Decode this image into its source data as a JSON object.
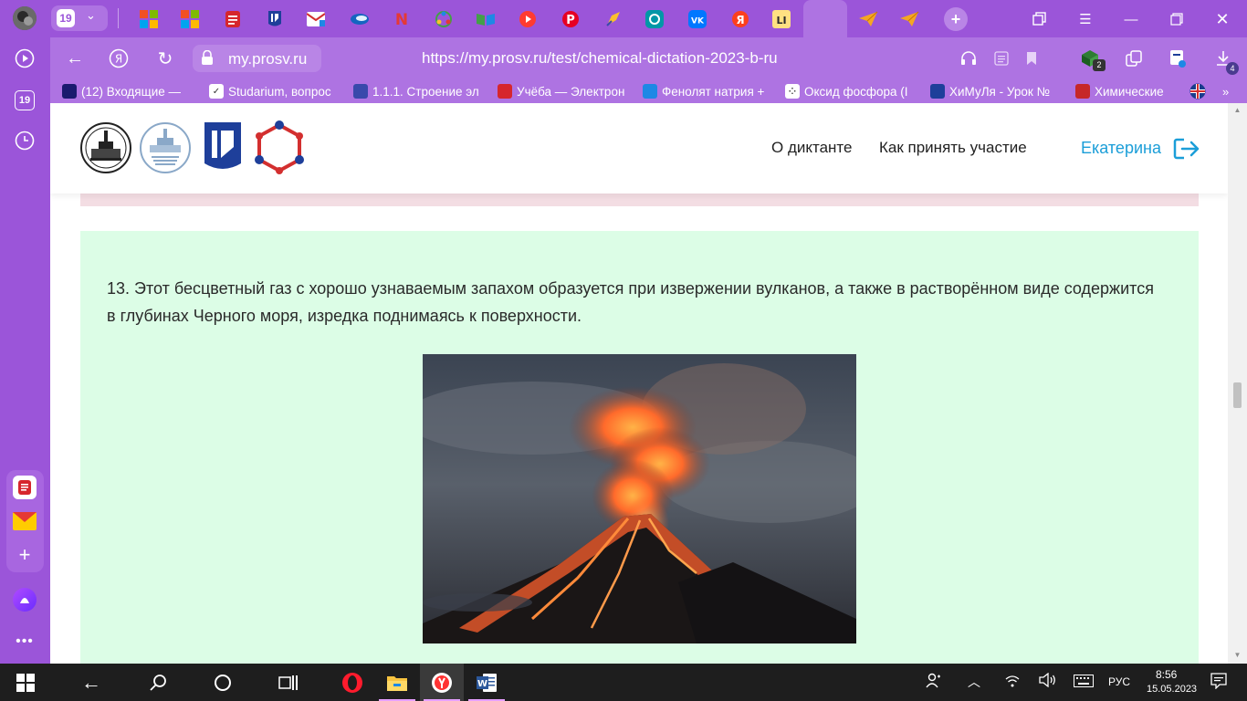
{
  "browser": {
    "tab_counter": "19",
    "url_domain": "my.prosv.ru",
    "url_full": "https://my.prosv.ru/test/chemical-dictation-2023-b-ru",
    "download_count": "4",
    "extension_count": "2",
    "tabs": [
      {
        "icon": "microsoft-icon",
        "color": "#f25022"
      },
      {
        "icon": "microsoft-icon",
        "color": "#7fba00"
      },
      {
        "icon": "document-icon",
        "color": "#d6262d"
      },
      {
        "icon": "prosv-logo-icon",
        "color": "#1e3f9a"
      },
      {
        "icon": "mail-icon",
        "color": "#1a1a6e"
      },
      {
        "icon": "edge-icon",
        "color": "#1565c0"
      },
      {
        "icon": "letter-n-icon",
        "color": "#e53935"
      },
      {
        "icon": "molecule-icon",
        "color": "#2e7d32"
      },
      {
        "icon": "book-icon",
        "color": "#2e7d32"
      },
      {
        "icon": "play-icon",
        "color": "#ff3b30"
      },
      {
        "icon": "pinterest-icon",
        "color": "#e60023"
      },
      {
        "icon": "rocket-icon",
        "color": "#3949ab"
      },
      {
        "icon": "chemistry-icon",
        "color": "#0097a7"
      },
      {
        "icon": "vk-icon",
        "color": "#0077ff"
      },
      {
        "icon": "yandex-icon",
        "color": "#fc3f1d"
      },
      {
        "icon": "litres-icon",
        "color": "#2b2b2b"
      },
      {
        "icon": "prosv-logo-icon",
        "color": "#1e3f9a"
      },
      {
        "icon": "paper-plane-icon",
        "color": "#f5a623"
      },
      {
        "icon": "paper-plane-icon",
        "color": "#f5a623"
      }
    ]
  },
  "bookmarks": [
    {
      "label": "(12) Входящие —",
      "icon": "mail-icon",
      "color": "#1a1a6e"
    },
    {
      "label": "Studarium, вопрос",
      "icon": "bird-icon",
      "color": "#ffffff"
    },
    {
      "label": "1.1.1. Строение эл",
      "icon": "atom-icon",
      "color": "#3949ab"
    },
    {
      "label": "Учёба — Электрон",
      "icon": "document-icon",
      "color": "#d6262d"
    },
    {
      "label": "Фенолят натрия +",
      "icon": "ac-icon",
      "color": "#1e88e5"
    },
    {
      "label": "Оксид фосфора (I",
      "icon": "dots-icon",
      "color": "#ffffff"
    },
    {
      "label": "ХиМуЛя - Урок №",
      "icon": "window-icon",
      "color": "#1e3f9a"
    },
    {
      "label": "Химические",
      "icon": "flask-icon",
      "color": "#c62828"
    }
  ],
  "site": {
    "nav_about": "О диктанте",
    "nav_how": "Как принять участие",
    "user_name": "Екатерина"
  },
  "question": {
    "text": "13. Этот бесцветный газ с хорошо узнаваемым запахом образуется при извержении вулканов, а также в растворённом виде содержится в глубинах Черного моря, изредка поднимаясь к поверхности."
  },
  "taskbar": {
    "language": "РУС",
    "time": "8:56",
    "date": "15.05.2023"
  }
}
